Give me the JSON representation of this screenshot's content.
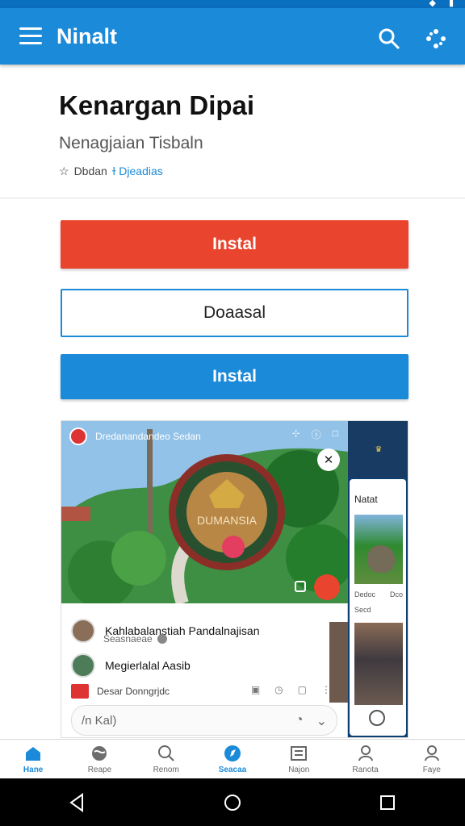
{
  "app": {
    "title": "Ninalt"
  },
  "status": {
    "signal": "◆",
    "battery": "▮"
  },
  "header": {
    "title": "Kenargan Dipai",
    "subtitle": "Nenagjaian Tisbaln",
    "meta_star": "☆",
    "meta_text": "Dbdan",
    "meta_link": "ɫ Djeadias"
  },
  "buttons": {
    "install": "Instal",
    "secondary": "Doaasal",
    "third": "Instal"
  },
  "preview": {
    "top_label": "Dredanandandeo Sedan",
    "badge_text": "DUMANSIA",
    "post_title": "Kahlabalanstiah Pandalnajisan",
    "post_subtitle": "Seasnaeae",
    "second_post": "Megierlalal Aasib",
    "shop_label": "Desar Donngrjdc",
    "compose_placeholder": "/n Kal)",
    "side_label": "Natat",
    "side_meta_left": "Dedoc",
    "side_meta_right": "Dco",
    "side_small": "Secd"
  },
  "bottom_nav": [
    {
      "label": "Hane",
      "active": true,
      "icon": "home-icon"
    },
    {
      "label": "Reape",
      "active": false,
      "icon": "globe-icon"
    },
    {
      "label": "Renom",
      "active": false,
      "icon": "search-icon"
    },
    {
      "label": "Seacaa",
      "active": true,
      "icon": "compass-icon"
    },
    {
      "label": "Najon",
      "active": false,
      "icon": "news-icon"
    },
    {
      "label": "Ranota",
      "active": false,
      "icon": "profile-icon"
    },
    {
      "label": "Faye",
      "active": false,
      "icon": "account-icon"
    }
  ],
  "colors": {
    "primary": "#1b8ad9",
    "install": "#e9442d",
    "dark_panel": "#0f3f72"
  }
}
